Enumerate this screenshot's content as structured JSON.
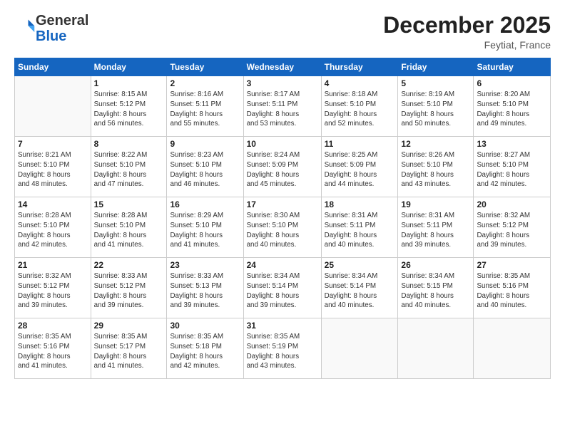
{
  "logo": {
    "general": "General",
    "blue": "Blue"
  },
  "header": {
    "month": "December 2025",
    "location": "Feytiat, France"
  },
  "days_of_week": [
    "Sunday",
    "Monday",
    "Tuesday",
    "Wednesday",
    "Thursday",
    "Friday",
    "Saturday"
  ],
  "weeks": [
    [
      {
        "day": "",
        "info": ""
      },
      {
        "day": "1",
        "info": "Sunrise: 8:15 AM\nSunset: 5:12 PM\nDaylight: 8 hours\nand 56 minutes."
      },
      {
        "day": "2",
        "info": "Sunrise: 8:16 AM\nSunset: 5:11 PM\nDaylight: 8 hours\nand 55 minutes."
      },
      {
        "day": "3",
        "info": "Sunrise: 8:17 AM\nSunset: 5:11 PM\nDaylight: 8 hours\nand 53 minutes."
      },
      {
        "day": "4",
        "info": "Sunrise: 8:18 AM\nSunset: 5:10 PM\nDaylight: 8 hours\nand 52 minutes."
      },
      {
        "day": "5",
        "info": "Sunrise: 8:19 AM\nSunset: 5:10 PM\nDaylight: 8 hours\nand 50 minutes."
      },
      {
        "day": "6",
        "info": "Sunrise: 8:20 AM\nSunset: 5:10 PM\nDaylight: 8 hours\nand 49 minutes."
      }
    ],
    [
      {
        "day": "7",
        "info": "Sunrise: 8:21 AM\nSunset: 5:10 PM\nDaylight: 8 hours\nand 48 minutes."
      },
      {
        "day": "8",
        "info": "Sunrise: 8:22 AM\nSunset: 5:10 PM\nDaylight: 8 hours\nand 47 minutes."
      },
      {
        "day": "9",
        "info": "Sunrise: 8:23 AM\nSunset: 5:10 PM\nDaylight: 8 hours\nand 46 minutes."
      },
      {
        "day": "10",
        "info": "Sunrise: 8:24 AM\nSunset: 5:09 PM\nDaylight: 8 hours\nand 45 minutes."
      },
      {
        "day": "11",
        "info": "Sunrise: 8:25 AM\nSunset: 5:09 PM\nDaylight: 8 hours\nand 44 minutes."
      },
      {
        "day": "12",
        "info": "Sunrise: 8:26 AM\nSunset: 5:10 PM\nDaylight: 8 hours\nand 43 minutes."
      },
      {
        "day": "13",
        "info": "Sunrise: 8:27 AM\nSunset: 5:10 PM\nDaylight: 8 hours\nand 42 minutes."
      }
    ],
    [
      {
        "day": "14",
        "info": "Sunrise: 8:28 AM\nSunset: 5:10 PM\nDaylight: 8 hours\nand 42 minutes."
      },
      {
        "day": "15",
        "info": "Sunrise: 8:28 AM\nSunset: 5:10 PM\nDaylight: 8 hours\nand 41 minutes."
      },
      {
        "day": "16",
        "info": "Sunrise: 8:29 AM\nSunset: 5:10 PM\nDaylight: 8 hours\nand 41 minutes."
      },
      {
        "day": "17",
        "info": "Sunrise: 8:30 AM\nSunset: 5:10 PM\nDaylight: 8 hours\nand 40 minutes."
      },
      {
        "day": "18",
        "info": "Sunrise: 8:31 AM\nSunset: 5:11 PM\nDaylight: 8 hours\nand 40 minutes."
      },
      {
        "day": "19",
        "info": "Sunrise: 8:31 AM\nSunset: 5:11 PM\nDaylight: 8 hours\nand 39 minutes."
      },
      {
        "day": "20",
        "info": "Sunrise: 8:32 AM\nSunset: 5:12 PM\nDaylight: 8 hours\nand 39 minutes."
      }
    ],
    [
      {
        "day": "21",
        "info": "Sunrise: 8:32 AM\nSunset: 5:12 PM\nDaylight: 8 hours\nand 39 minutes."
      },
      {
        "day": "22",
        "info": "Sunrise: 8:33 AM\nSunset: 5:12 PM\nDaylight: 8 hours\nand 39 minutes."
      },
      {
        "day": "23",
        "info": "Sunrise: 8:33 AM\nSunset: 5:13 PM\nDaylight: 8 hours\nand 39 minutes."
      },
      {
        "day": "24",
        "info": "Sunrise: 8:34 AM\nSunset: 5:14 PM\nDaylight: 8 hours\nand 39 minutes."
      },
      {
        "day": "25",
        "info": "Sunrise: 8:34 AM\nSunset: 5:14 PM\nDaylight: 8 hours\nand 40 minutes."
      },
      {
        "day": "26",
        "info": "Sunrise: 8:34 AM\nSunset: 5:15 PM\nDaylight: 8 hours\nand 40 minutes."
      },
      {
        "day": "27",
        "info": "Sunrise: 8:35 AM\nSunset: 5:16 PM\nDaylight: 8 hours\nand 40 minutes."
      }
    ],
    [
      {
        "day": "28",
        "info": "Sunrise: 8:35 AM\nSunset: 5:16 PM\nDaylight: 8 hours\nand 41 minutes."
      },
      {
        "day": "29",
        "info": "Sunrise: 8:35 AM\nSunset: 5:17 PM\nDaylight: 8 hours\nand 41 minutes."
      },
      {
        "day": "30",
        "info": "Sunrise: 8:35 AM\nSunset: 5:18 PM\nDaylight: 8 hours\nand 42 minutes."
      },
      {
        "day": "31",
        "info": "Sunrise: 8:35 AM\nSunset: 5:19 PM\nDaylight: 8 hours\nand 43 minutes."
      },
      {
        "day": "",
        "info": ""
      },
      {
        "day": "",
        "info": ""
      },
      {
        "day": "",
        "info": ""
      }
    ]
  ]
}
